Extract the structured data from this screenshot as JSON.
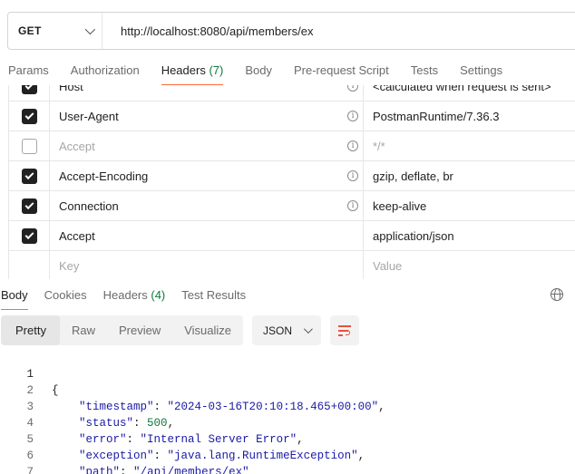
{
  "request": {
    "method": "GET",
    "url": "http://localhost:8080/api/members/ex"
  },
  "request_tabs": {
    "params": "Params",
    "authorization": "Authorization",
    "headers": "Headers",
    "headers_count": "(7)",
    "body": "Body",
    "pre_request_script": "Pre-request Script",
    "tests": "Tests",
    "settings": "Settings"
  },
  "headers_rows": [
    {
      "key": "Host",
      "value": "<calculated when request is sent>",
      "checked": true
    },
    {
      "key": "User-Agent",
      "value": "PostmanRuntime/7.36.3",
      "checked": true
    },
    {
      "key": "Accept",
      "value": "*/*",
      "checked": false
    },
    {
      "key": "Accept-Encoding",
      "value": "gzip, deflate, br",
      "checked": true
    },
    {
      "key": "Connection",
      "value": "keep-alive",
      "checked": true
    },
    {
      "key": "Accept",
      "value": "application/json",
      "checked": true
    }
  ],
  "headers_placeholder": {
    "key": "Key",
    "value": "Value"
  },
  "response_tabs": {
    "body": "Body",
    "cookies": "Cookies",
    "headers": "Headers",
    "headers_count": "(4)",
    "test_results": "Test Results"
  },
  "view_toolbar": {
    "pretty": "Pretty",
    "raw": "Raw",
    "preview": "Preview",
    "visualize": "Visualize",
    "format": "JSON"
  },
  "response_body": {
    "line_numbers": [
      "1",
      "2",
      "3",
      "4",
      "5",
      "6",
      "7"
    ],
    "open_brace": "{",
    "close_brace": "}",
    "timestamp_key": "\"timestamp\"",
    "timestamp_value": "\"2024-03-16T20:10:18.465+00:00\"",
    "status_key": "\"status\"",
    "status_value": "500",
    "error_key": "\"error\"",
    "error_value": "\"Internal Server Error\"",
    "exception_key": "\"exception\"",
    "exception_value": "\"java.lang.RuntimeException\"",
    "path_key": "\"path\"",
    "path_value_q": "\"",
    "path_value": "/api/members/ex"
  },
  "icons": {
    "method_dropdown": "chevron-down-icon",
    "info": "info-icon",
    "globe": "globe-icon",
    "wrap": "wrap-lines-icon"
  },
  "colors": {
    "active_tab_underline": "#ff6c37",
    "count_green": "#0b7a3e",
    "json_string": "#1a1aa6",
    "json_number": "#0b7a3e",
    "wrap_icon": "#e5533d"
  }
}
